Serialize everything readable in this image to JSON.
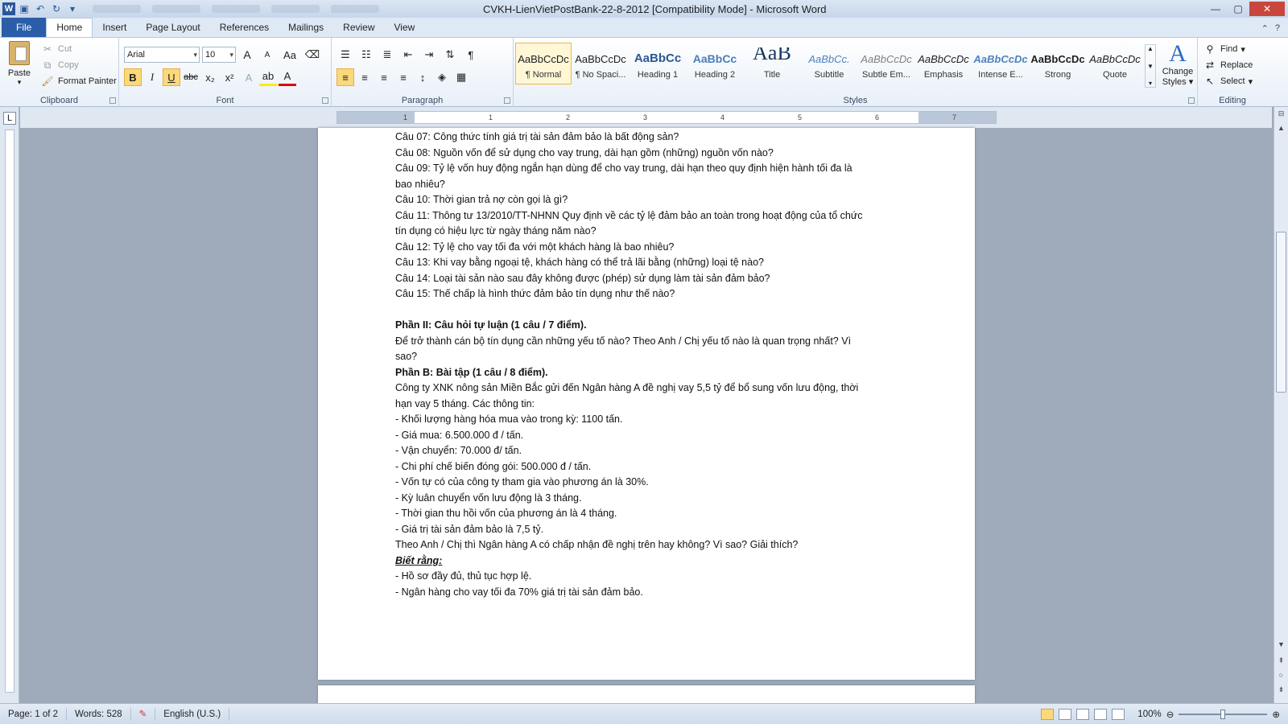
{
  "window": {
    "title": "CVKH-LienVietPostBank-22-8-2012 [Compatibility Mode] - Microsoft Word",
    "word_icon": "W",
    "minimize": "—",
    "maximize": "▢",
    "close": "✕"
  },
  "tabs": {
    "file": "File",
    "items": [
      "Home",
      "Insert",
      "Page Layout",
      "References",
      "Mailings",
      "Review",
      "View"
    ]
  },
  "ribbon": {
    "clipboard": {
      "label": "Clipboard",
      "paste": "Paste",
      "cut": "Cut",
      "copy": "Copy",
      "format_painter": "Format Painter"
    },
    "font": {
      "label": "Font",
      "font_name": "Arial",
      "font_size": "10",
      "grow": "A",
      "shrink": "A",
      "change_case": "Aa",
      "bold": "B",
      "italic": "I",
      "underline": "U",
      "strike": "abc",
      "subscript": "x₂",
      "superscript": "x²"
    },
    "paragraph": {
      "label": "Paragraph",
      "pilcrow": "¶"
    },
    "styles": {
      "label": "Styles",
      "items": [
        {
          "preview": "AaBbCcDc",
          "name": "¶ Normal"
        },
        {
          "preview": "AaBbCcDc",
          "name": "¶ No Spaci..."
        },
        {
          "preview": "AaBbCc",
          "name": "Heading 1"
        },
        {
          "preview": "AaBbCc",
          "name": "Heading 2"
        },
        {
          "preview": "AaB",
          "name": "Title"
        },
        {
          "preview": "AaBbCc.",
          "name": "Subtitle"
        },
        {
          "preview": "AaBbCcDc",
          "name": "Subtle Em..."
        },
        {
          "preview": "AaBbCcDc",
          "name": "Emphasis"
        },
        {
          "preview": "AaBbCcDc",
          "name": "Intense E..."
        },
        {
          "preview": "AaBbCcDc",
          "name": "Strong"
        },
        {
          "preview": "AaBbCcDc",
          "name": "Quote"
        }
      ],
      "change_styles_line1": "Change",
      "change_styles_line2": "Styles"
    },
    "editing": {
      "label": "Editing",
      "find": "Find",
      "replace": "Replace",
      "select": "Select"
    }
  },
  "document": {
    "lines": [
      {
        "text": "Câu  07: Công thức tính giá trị tài sản đảm bảo là bất động sản?",
        "style": ""
      },
      {
        "text": "Câu  08: Nguồn vốn để sử dụng cho vay trung, dài hạn gồm (những) nguồn vốn nào?",
        "style": ""
      },
      {
        "text": "Câu  09: Tỷ lệ vốn huy động ngắn hạn dùng để cho vay trung, dài hạn theo quy định hiện hành tối đa là",
        "style": ""
      },
      {
        "text": "bao nhiêu?",
        "style": ""
      },
      {
        "text": "Câu  10: Thời gian trả nợ còn gọi là gì?",
        "style": ""
      },
      {
        "text": "Câu  11: Thông tư 13/2010/TT-NHNN  Quy định về các tỷ lệ đảm bảo an toàn trong hoạt động của tổ chức",
        "style": ""
      },
      {
        "text": "tín dụng có hiệu lực từ ngày tháng năm nào?",
        "style": ""
      },
      {
        "text": "Câu  12: Tỷ lệ cho vay tối đa với một khách hàng là bao nhiêu?",
        "style": ""
      },
      {
        "text": "Câu  13: Khi vay bằng ngoại tệ, khách hàng có thể trả lãi bằng (những) loại tệ nào?",
        "style": ""
      },
      {
        "text": "Câu  14: Loại tài sản nào sau đây không được (phép) sử dụng làm tài sản đảm bảo?",
        "style": ""
      },
      {
        "text": "Câu  15: Thế chấp là hình thức đảm bảo tín dụng như thế nào?",
        "style": ""
      },
      {
        "text": "",
        "style": "blank"
      },
      {
        "text": "Phần II: Câu hỏi tự luận (1 câu / 7 điểm).",
        "style": "b"
      },
      {
        "text": "Để trở thành cán bộ tín dụng cần những yếu tố nào? Theo Anh / Chị yếu tố nào là quan trọng nhất? Vì",
        "style": ""
      },
      {
        "text": "sao?",
        "style": ""
      },
      {
        "text": "Phần B: Bài tập (1 câu / 8 điểm).",
        "style": "b"
      },
      {
        "text": "Công ty XNK nông sản Miền Bắc gửi đến Ngân hàng A đề nghị vay 5,5 tỷ để bổ sung vốn lưu động, thời",
        "style": ""
      },
      {
        "text": "hạn vay 5 tháng. Các thông tin:",
        "style": ""
      },
      {
        "text": "- Khối lượng hàng hóa mua vào trong kỳ: 1100 tấn.",
        "style": ""
      },
      {
        "text": "- Giá mua: 6.500.000  đ / tấn.",
        "style": ""
      },
      {
        "text": "- Vận chuyển: 70.000  đ/ tấn.",
        "style": ""
      },
      {
        "text": "- Chi phí chế biến đóng gói: 500.000 đ / tấn.",
        "style": ""
      },
      {
        "text": "- Vốn tự có của công ty tham gia vào phương án là 30%.",
        "style": ""
      },
      {
        "text": "- Kỳ luân chuyển vốn lưu động là 3 tháng.",
        "style": ""
      },
      {
        "text": "- Thời gian thu hồi vốn của phương án là 4 tháng.",
        "style": ""
      },
      {
        "text": "- Giá trị tài sản đảm bảo là 7,5 tỷ.",
        "style": ""
      },
      {
        "text": "Theo Anh / Chị thì Ngân hàng A có chấp nhận  đề nghị trên hay không? Vì sao? Giải thích?",
        "style": ""
      },
      {
        "text": "Biết rằng:",
        "style": "bi"
      },
      {
        "text": "- Hồ sơ đầy đủ, thủ tục hợp lệ.",
        "style": ""
      },
      {
        "text": "- Ngân hàng cho vay tối đa 70%  giá trị tài sản đảm bảo.",
        "style": ""
      }
    ]
  },
  "ruler_ticks": [
    "1",
    "1",
    "2",
    "3",
    "4",
    "5",
    "6",
    "7"
  ],
  "statusbar": {
    "page": "Page: 1 of 2",
    "words": "Words: 528",
    "language": "English (U.S.)",
    "zoom": "100%",
    "zoom_level_percent": 100
  },
  "colors": {
    "file_tab": "#2a5ea8",
    "selected_style": "#fff7d6",
    "active_toggle": "#fbd87a"
  }
}
